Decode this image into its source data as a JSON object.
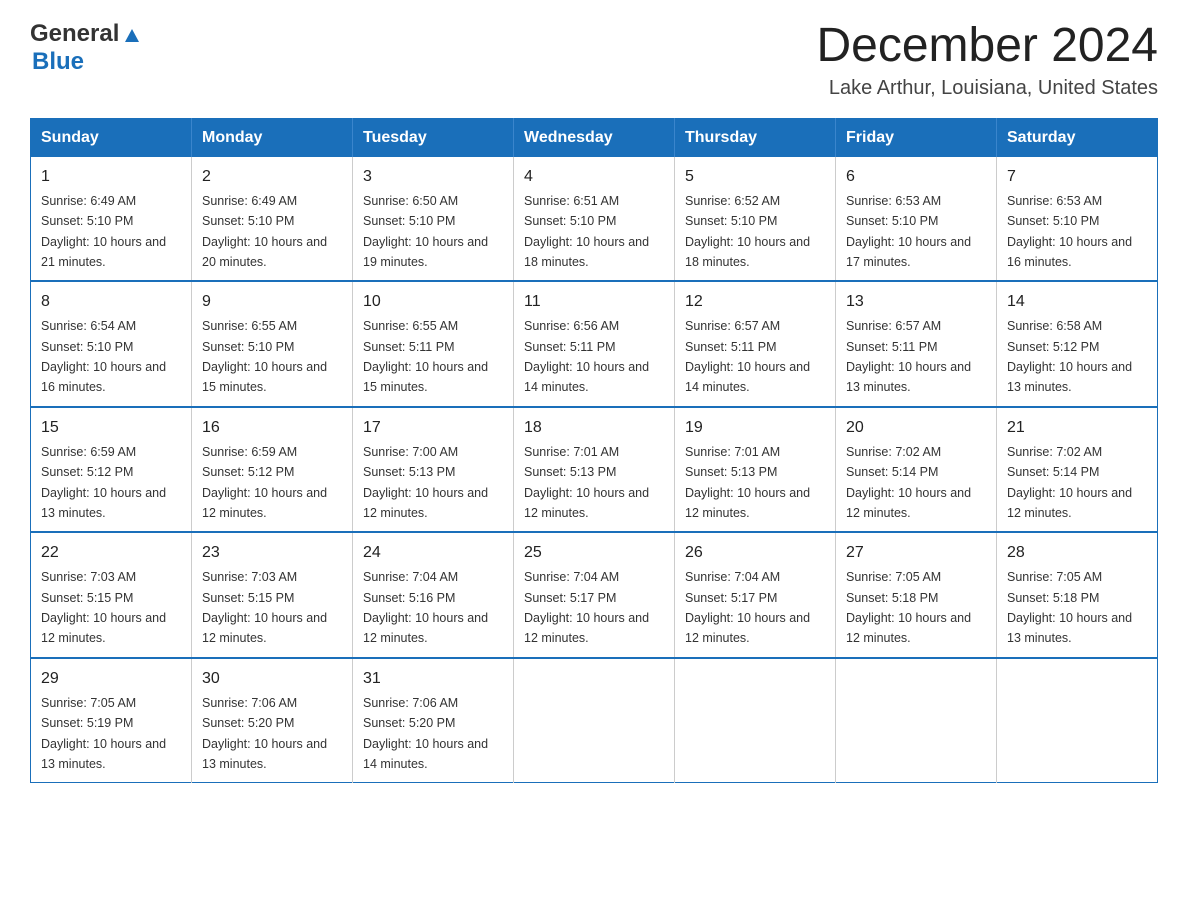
{
  "header": {
    "logo": {
      "general": "General",
      "blue": "Blue"
    },
    "title": "December 2024",
    "subtitle": "Lake Arthur, Louisiana, United States"
  },
  "calendar": {
    "days_of_week": [
      "Sunday",
      "Monday",
      "Tuesday",
      "Wednesday",
      "Thursday",
      "Friday",
      "Saturday"
    ],
    "weeks": [
      [
        {
          "day": "1",
          "sunrise": "6:49 AM",
          "sunset": "5:10 PM",
          "daylight": "10 hours and 21 minutes."
        },
        {
          "day": "2",
          "sunrise": "6:49 AM",
          "sunset": "5:10 PM",
          "daylight": "10 hours and 20 minutes."
        },
        {
          "day": "3",
          "sunrise": "6:50 AM",
          "sunset": "5:10 PM",
          "daylight": "10 hours and 19 minutes."
        },
        {
          "day": "4",
          "sunrise": "6:51 AM",
          "sunset": "5:10 PM",
          "daylight": "10 hours and 18 minutes."
        },
        {
          "day": "5",
          "sunrise": "6:52 AM",
          "sunset": "5:10 PM",
          "daylight": "10 hours and 18 minutes."
        },
        {
          "day": "6",
          "sunrise": "6:53 AM",
          "sunset": "5:10 PM",
          "daylight": "10 hours and 17 minutes."
        },
        {
          "day": "7",
          "sunrise": "6:53 AM",
          "sunset": "5:10 PM",
          "daylight": "10 hours and 16 minutes."
        }
      ],
      [
        {
          "day": "8",
          "sunrise": "6:54 AM",
          "sunset": "5:10 PM",
          "daylight": "10 hours and 16 minutes."
        },
        {
          "day": "9",
          "sunrise": "6:55 AM",
          "sunset": "5:10 PM",
          "daylight": "10 hours and 15 minutes."
        },
        {
          "day": "10",
          "sunrise": "6:55 AM",
          "sunset": "5:11 PM",
          "daylight": "10 hours and 15 minutes."
        },
        {
          "day": "11",
          "sunrise": "6:56 AM",
          "sunset": "5:11 PM",
          "daylight": "10 hours and 14 minutes."
        },
        {
          "day": "12",
          "sunrise": "6:57 AM",
          "sunset": "5:11 PM",
          "daylight": "10 hours and 14 minutes."
        },
        {
          "day": "13",
          "sunrise": "6:57 AM",
          "sunset": "5:11 PM",
          "daylight": "10 hours and 13 minutes."
        },
        {
          "day": "14",
          "sunrise": "6:58 AM",
          "sunset": "5:12 PM",
          "daylight": "10 hours and 13 minutes."
        }
      ],
      [
        {
          "day": "15",
          "sunrise": "6:59 AM",
          "sunset": "5:12 PM",
          "daylight": "10 hours and 13 minutes."
        },
        {
          "day": "16",
          "sunrise": "6:59 AM",
          "sunset": "5:12 PM",
          "daylight": "10 hours and 12 minutes."
        },
        {
          "day": "17",
          "sunrise": "7:00 AM",
          "sunset": "5:13 PM",
          "daylight": "10 hours and 12 minutes."
        },
        {
          "day": "18",
          "sunrise": "7:01 AM",
          "sunset": "5:13 PM",
          "daylight": "10 hours and 12 minutes."
        },
        {
          "day": "19",
          "sunrise": "7:01 AM",
          "sunset": "5:13 PM",
          "daylight": "10 hours and 12 minutes."
        },
        {
          "day": "20",
          "sunrise": "7:02 AM",
          "sunset": "5:14 PM",
          "daylight": "10 hours and 12 minutes."
        },
        {
          "day": "21",
          "sunrise": "7:02 AM",
          "sunset": "5:14 PM",
          "daylight": "10 hours and 12 minutes."
        }
      ],
      [
        {
          "day": "22",
          "sunrise": "7:03 AM",
          "sunset": "5:15 PM",
          "daylight": "10 hours and 12 minutes."
        },
        {
          "day": "23",
          "sunrise": "7:03 AM",
          "sunset": "5:15 PM",
          "daylight": "10 hours and 12 minutes."
        },
        {
          "day": "24",
          "sunrise": "7:04 AM",
          "sunset": "5:16 PM",
          "daylight": "10 hours and 12 minutes."
        },
        {
          "day": "25",
          "sunrise": "7:04 AM",
          "sunset": "5:17 PM",
          "daylight": "10 hours and 12 minutes."
        },
        {
          "day": "26",
          "sunrise": "7:04 AM",
          "sunset": "5:17 PM",
          "daylight": "10 hours and 12 minutes."
        },
        {
          "day": "27",
          "sunrise": "7:05 AM",
          "sunset": "5:18 PM",
          "daylight": "10 hours and 12 minutes."
        },
        {
          "day": "28",
          "sunrise": "7:05 AM",
          "sunset": "5:18 PM",
          "daylight": "10 hours and 13 minutes."
        }
      ],
      [
        {
          "day": "29",
          "sunrise": "7:05 AM",
          "sunset": "5:19 PM",
          "daylight": "10 hours and 13 minutes."
        },
        {
          "day": "30",
          "sunrise": "7:06 AM",
          "sunset": "5:20 PM",
          "daylight": "10 hours and 13 minutes."
        },
        {
          "day": "31",
          "sunrise": "7:06 AM",
          "sunset": "5:20 PM",
          "daylight": "10 hours and 14 minutes."
        },
        null,
        null,
        null,
        null
      ]
    ]
  }
}
